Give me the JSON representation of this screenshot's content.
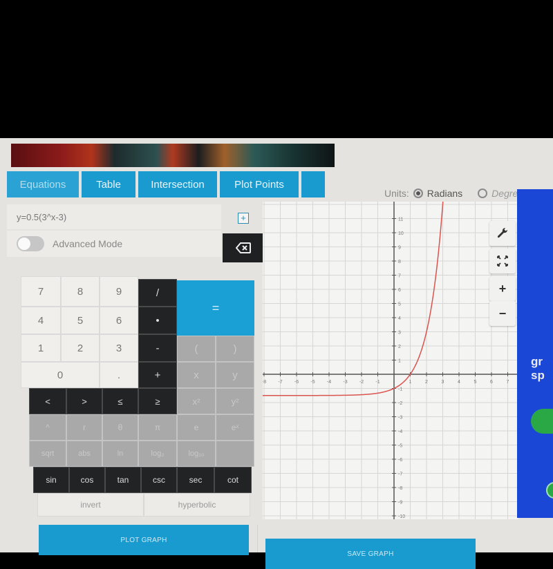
{
  "tabs": [
    {
      "label": "Equations",
      "active": true
    },
    {
      "label": "Table",
      "active": false
    },
    {
      "label": "Intersection",
      "active": false
    },
    {
      "label": "Plot Points",
      "active": false
    },
    {
      "label": "",
      "active": false
    }
  ],
  "units": {
    "label": "Units:",
    "options": [
      {
        "label": "Radians",
        "selected": true
      },
      {
        "label": "Degrees",
        "selected": false
      }
    ]
  },
  "equation": {
    "value": "y=0.5(3^x-3)",
    "add_label": "+"
  },
  "advanced_mode": {
    "label": "Advanced Mode",
    "enabled": false
  },
  "keypad": {
    "digits": [
      "7",
      "8",
      "9",
      "4",
      "5",
      "6",
      "1",
      "2",
      "3",
      "0",
      "."
    ],
    "operators": [
      "/",
      "•",
      "-",
      "+"
    ],
    "equals": "=",
    "paren_open": "(",
    "paren_close": ")",
    "var_x": "x",
    "var_y": "y",
    "comparisons": [
      "<",
      ">",
      "≤",
      "≥"
    ],
    "x_squared": "x²",
    "y_squared": "y²",
    "row_special": [
      "^",
      "r",
      "θ",
      "π",
      "e",
      "eˣ"
    ],
    "row_funcs": [
      "sqrt",
      "abs",
      "ln",
      "log₂",
      "log₁₀",
      ""
    ],
    "trig": [
      "sin",
      "cos",
      "tan",
      "csc",
      "sec",
      "cot"
    ],
    "invert": "invert",
    "hyperbolic": "hyperbolic"
  },
  "graph": {
    "equation": "y=0.5(3^x-3)",
    "x_ticks": [
      "-8",
      "-7",
      "-6",
      "-5",
      "-4",
      "-3",
      "-2",
      "-1",
      "1",
      "2",
      "3",
      "4",
      "5",
      "6",
      "7"
    ],
    "y_ticks": [
      "11",
      "10",
      "9",
      "8",
      "7",
      "6",
      "5",
      "4",
      "3",
      "2",
      "1",
      "-1",
      "-2",
      "-3",
      "-4",
      "-5",
      "-6",
      "-7",
      "-8",
      "-9",
      "-10"
    ],
    "x_range": [
      -8,
      7
    ],
    "y_range": [
      -11,
      11
    ],
    "curve_color": "#d9534f",
    "controls": [
      "wrench-icon",
      "fullscreen-icon",
      "zoom-in",
      "zoom-out"
    ],
    "zoom_in_label": "+",
    "zoom_out_label": "−"
  },
  "ad": {
    "text_line1": "gr",
    "text_line2": "sp"
  },
  "buttons": {
    "plot": "PLOT GRAPH",
    "save": "SAVE GRAPH"
  },
  "colors": {
    "accent": "#1a9bd0",
    "dark_key": "#222325",
    "gray_key": "#a9a9a9",
    "ad_blue": "#1a47d6"
  }
}
